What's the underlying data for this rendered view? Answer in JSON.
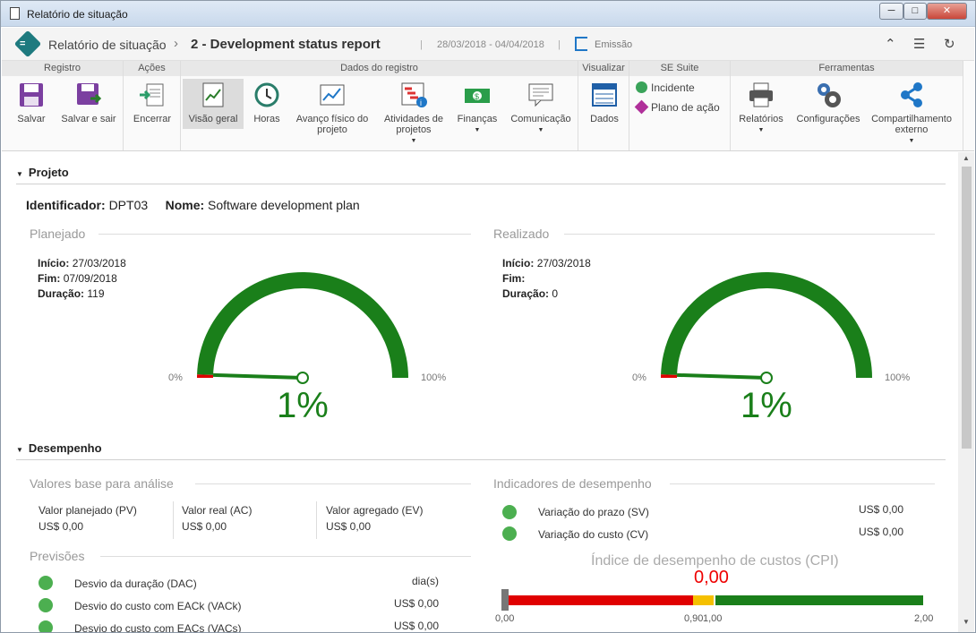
{
  "window": {
    "title": "Relatório de situação",
    "min": "─",
    "max": "□",
    "close": "✕"
  },
  "header": {
    "crumb1": "Relatório de situação",
    "crumb2": "2 - Development status report",
    "dates": "28/03/2018 - 04/04/2018",
    "emission": "Emissão"
  },
  "ribbon": {
    "groups": [
      "Registro",
      "Ações",
      "Dados do registro",
      "Visualizar",
      "SE Suite",
      "Ferramentas"
    ],
    "save": "Salvar",
    "save_exit": "Salvar e sair",
    "close": "Encerrar",
    "overview": "Visão geral",
    "hours": "Horas",
    "physical_a": "Avanço físico do",
    "physical_b": "projeto",
    "activities_a": "Atividades de",
    "activities_b": "projetos",
    "finance": "Finanças",
    "comm": "Comunicação",
    "data": "Dados",
    "incident": "Incidente",
    "action_plan": "Plano de ação",
    "reports": "Relatórios",
    "config": "Configurações",
    "share_a": "Compartilhamento",
    "share_b": "externo"
  },
  "project": {
    "section": "Projeto",
    "id_label": "Identificador:",
    "id": "DPT03",
    "name_label": "Nome:",
    "name": "Software development plan"
  },
  "planned": {
    "title": "Planejado",
    "start_label": "Início:",
    "start": "27/03/2018",
    "end_label": "Fim:",
    "end": "07/09/2018",
    "dur_label": "Duração:",
    "dur": "119",
    "percent_text": "1%",
    "value": 1,
    "min": "0%",
    "max": "100%"
  },
  "actual": {
    "title": "Realizado",
    "start_label": "Início:",
    "start": "27/03/2018",
    "end_label": "Fim:",
    "end": "",
    "dur_label": "Duração:",
    "dur": "0",
    "percent_text": "1%",
    "value": 1,
    "min": "0%",
    "max": "100%"
  },
  "performance": {
    "section": "Desempenho",
    "base_title": "Valores base para análise",
    "pv_label": "Valor planejado (PV)",
    "pv": "US$ 0,00",
    "ac_label": "Valor real (AC)",
    "ac": "US$ 0,00",
    "ev_label": "Valor agregado (EV)",
    "ev": "US$ 0,00",
    "forecast_title": "Previsões",
    "dac_label": "Desvio da duração (DAC)",
    "dac": "dia(s)",
    "vack_label": "Desvio do custo com EACk (VACk)",
    "vack": "US$ 0,00",
    "vacs_label": "Desvio do custo com EACs (VACs)",
    "vacs": "US$ 0,00",
    "ind_title": "Indicadores de desempenho",
    "sv_label": "Variação do prazo (SV)",
    "sv": "US$ 0,00",
    "cv_label": "Variação do custo (CV)",
    "cv": "US$ 0,00",
    "cpi_title": "Índice de desempenho de custos (CPI)",
    "cpi": "0,00",
    "cpi_min": "0,00",
    "cpi_t1": "0,90",
    "cpi_t2": "1,00",
    "cpi_max": "2,00",
    "colors": {
      "good": "#4caf50",
      "bad": "#e00000",
      "warn": "#f5c000",
      "ok": "#1a7f1a"
    }
  }
}
